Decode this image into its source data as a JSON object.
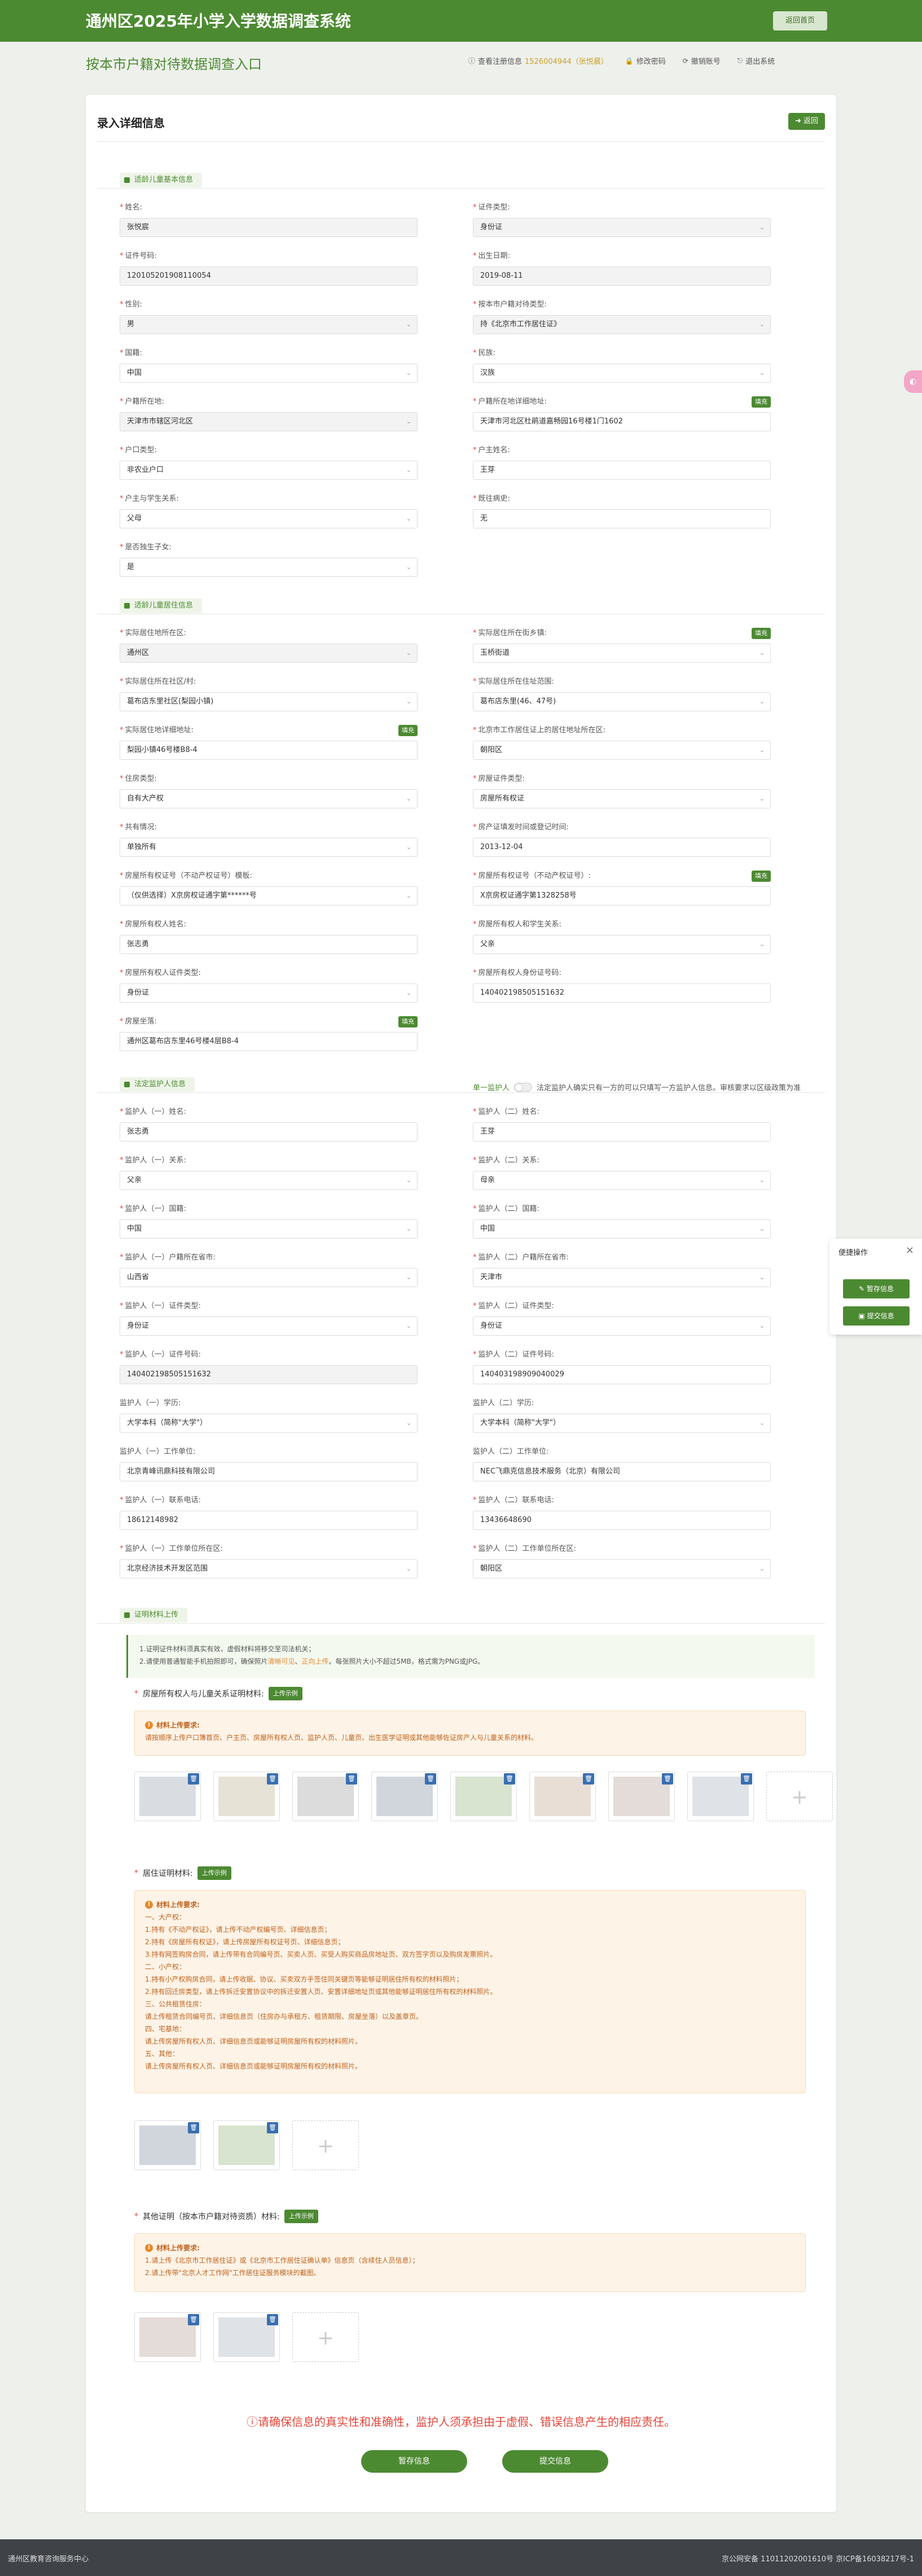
{
  "header": {
    "title": "通州区2025年小学入学数据调查系统",
    "home_button": "返回首页"
  },
  "subheader": {
    "subtitle": "按本市户籍对待数据调查入口",
    "reg_info_label": "查看注册信息",
    "reg_info_value": "1526004944（张悦晨）",
    "change_password": "修改密码",
    "cancel_account": "撤销账号",
    "logout": "退出系统"
  },
  "card": {
    "title": "录入详细信息",
    "back_button": "返回"
  },
  "sections": {
    "child_basic": "适龄儿童基本信息",
    "child_residence": "适龄儿童居住信息",
    "guardian": "法定监护人信息",
    "materials": "证明材料上传"
  },
  "child_basic": [
    {
      "label": "姓名:",
      "value": "张悦宸",
      "req": true,
      "dis": true,
      "select": false
    },
    {
      "label": "证件类型:",
      "value": "身份证",
      "req": true,
      "dis": true,
      "select": true
    },
    {
      "label": "证件号码:",
      "value": "120105201908110054",
      "req": true,
      "dis": true,
      "select": false
    },
    {
      "label": "出生日期:",
      "value": "2019-08-11",
      "req": true,
      "dis": true,
      "select": false
    },
    {
      "label": "性别:",
      "value": "男",
      "req": true,
      "dis": true,
      "select": true
    },
    {
      "label": "按本市户籍对待类型:",
      "value": "持《北京市工作居住证》",
      "req": true,
      "dis": true,
      "select": true
    },
    {
      "label": "国籍:",
      "value": "中国",
      "req": true,
      "dis": false,
      "select": true
    },
    {
      "label": "民族:",
      "value": "汉族",
      "req": true,
      "dis": false,
      "select": true
    },
    {
      "label": "户籍所在地:",
      "value": "天津市市辖区河北区",
      "req": true,
      "dis": true,
      "select": true
    },
    {
      "label": "户籍所在地详细地址:",
      "value": "天津市河北区杜鹃道嘉畅园16号楼1门1602",
      "req": true,
      "dis": false,
      "select": false,
      "fill": true
    },
    {
      "label": "户口类型:",
      "value": "非农业户口",
      "req": true,
      "dis": false,
      "select": true
    },
    {
      "label": "户主姓名:",
      "value": "王芽",
      "req": true,
      "dis": false,
      "select": false
    },
    {
      "label": "户主与学生关系:",
      "value": "父母",
      "req": true,
      "dis": false,
      "select": true
    },
    {
      "label": "既往病史:",
      "value": "无",
      "req": true,
      "dis": false,
      "select": false
    },
    {
      "label": "是否独生子女:",
      "value": "是",
      "req": true,
      "dis": false,
      "select": true
    }
  ],
  "child_residence": [
    {
      "label": "实际居住地所在区:",
      "value": "通州区",
      "req": true,
      "dis": true,
      "select": true
    },
    {
      "label": "实际居住所在街乡镇:",
      "value": "玉桥街道",
      "req": true,
      "dis": false,
      "select": true,
      "fill": true
    },
    {
      "label": "实际居住所在社区/村:",
      "value": "葛布店东里社区(梨园小镇)",
      "req": true,
      "dis": false,
      "select": true
    },
    {
      "label": "实际居住所在住址范围:",
      "value": "葛布店东里(46、47号)",
      "req": true,
      "dis": false,
      "select": true
    },
    {
      "label": "实际居住地详细地址:",
      "value": "梨园小镇46号楼B8-4",
      "req": true,
      "dis": false,
      "select": false,
      "fill": true
    },
    {
      "label": "北京市工作居住证上的居住地址所在区:",
      "value": "朝阳区",
      "req": true,
      "dis": false,
      "select": true
    },
    {
      "label": "住房类型:",
      "value": "自有大产权",
      "req": true,
      "dis": false,
      "select": true
    },
    {
      "label": "房屋证件类型:",
      "value": "房屋所有权证",
      "req": true,
      "dis": false,
      "select": true
    },
    {
      "label": "共有情况:",
      "value": "单独所有",
      "req": true,
      "dis": false,
      "select": true
    },
    {
      "label": "房产证填发时间或登记时间:",
      "value": "2013-12-04",
      "req": true,
      "dis": false,
      "select": false
    },
    {
      "label": "房屋所有权证号（不动产权证号）模板:",
      "value": "（仅供选择）X京房权证通字第******号",
      "req": true,
      "dis": false,
      "select": true
    },
    {
      "label": "房屋所有权证号（不动产权证号）:",
      "value": "X京房权证通字第1328258号",
      "req": true,
      "dis": false,
      "select": false,
      "fill": true
    },
    {
      "label": "房屋所有权人姓名:",
      "value": "张志勇",
      "req": true,
      "dis": false,
      "select": false
    },
    {
      "label": "房屋所有权人和学生关系:",
      "value": "父亲",
      "req": true,
      "dis": false,
      "select": true
    },
    {
      "label": "房屋所有权人证件类型:",
      "value": "身份证",
      "req": true,
      "dis": false,
      "select": true
    },
    {
      "label": "房屋所有权人身份证号码:",
      "value": "140402198505151632",
      "req": true,
      "dis": false,
      "select": false
    },
    {
      "label": "房屋坐落:",
      "value": "通州区葛布店东里46号楼4层B8-4",
      "req": true,
      "dis": false,
      "select": false,
      "fill": true
    }
  ],
  "guardian_switch": {
    "label": "单一监护人",
    "note": "法定监护人确实只有一方的可以只填写一方监护人信息。审核要求以区级政策为准"
  },
  "guardian": [
    {
      "label": "监护人（一）姓名:",
      "value": "张志勇",
      "req": true,
      "dis": false,
      "select": false
    },
    {
      "label": "监护人（二）姓名:",
      "value": "王芽",
      "req": true,
      "dis": false,
      "select": false
    },
    {
      "label": "监护人（一）关系:",
      "value": "父亲",
      "req": true,
      "dis": false,
      "select": true
    },
    {
      "label": "监护人（二）关系:",
      "value": "母亲",
      "req": true,
      "dis": false,
      "select": true
    },
    {
      "label": "监护人（一）国籍:",
      "value": "中国",
      "req": true,
      "dis": false,
      "select": true
    },
    {
      "label": "监护人（二）国籍:",
      "value": "中国",
      "req": true,
      "dis": false,
      "select": true
    },
    {
      "label": "监护人（一）户籍所在省市:",
      "value": "山西省",
      "req": true,
      "dis": false,
      "select": true
    },
    {
      "label": "监护人（二）户籍所在省市:",
      "value": "天津市",
      "req": true,
      "dis": false,
      "select": true
    },
    {
      "label": "监护人（一）证件类型:",
      "value": "身份证",
      "req": true,
      "dis": false,
      "select": true
    },
    {
      "label": "监护人（二）证件类型:",
      "value": "身份证",
      "req": true,
      "dis": false,
      "select": true
    },
    {
      "label": "监护人（一）证件号码:",
      "value": "140402198505151632",
      "req": true,
      "dis": true,
      "select": false
    },
    {
      "label": "监护人（二）证件号码:",
      "value": "140403198909040029",
      "req": true,
      "dis": false,
      "select": false
    },
    {
      "label": "监护人（一）学历:",
      "value": "大学本科（简称\"大学\"）",
      "req": false,
      "dis": false,
      "select": true
    },
    {
      "label": "监护人（二）学历:",
      "value": "大学本科（简称\"大学\"）",
      "req": false,
      "dis": false,
      "select": true
    },
    {
      "label": "监护人（一）工作单位:",
      "value": "北京青峰讯鼎科技有限公司",
      "req": false,
      "dis": false,
      "select": false
    },
    {
      "label": "监护人（二）工作单位:",
      "value": "NEC飞鼎克信息技术服务（北京）有限公司",
      "req": false,
      "dis": false,
      "select": false
    },
    {
      "label": "监护人（一）联系电话:",
      "value": "18612148982",
      "req": true,
      "dis": false,
      "select": false
    },
    {
      "label": "监护人（二）联系电话:",
      "value": "13436648690",
      "req": true,
      "dis": false,
      "select": false
    },
    {
      "label": "监护人（一）工作单位所在区:",
      "value": "北京经济技术开发区范围",
      "req": true,
      "dis": false,
      "select": true
    },
    {
      "label": "监护人（二）工作单位所在区:",
      "value": "朝阳区",
      "req": true,
      "dis": false,
      "select": true
    }
  ],
  "notice": {
    "line1": "1.证明证件材料须真实有效，虚假材料将移交至司法机关；",
    "line2_prefix": "2.请使用普通智能手机拍照即可，确保照片",
    "line2_hl1": "清晰可见",
    "line2_sep": "、",
    "line2_hl2": "正向上传",
    "line2_suffix": "。每张照片大小不超过5MB，格式需为PNG或JPG。"
  },
  "uploads": [
    {
      "title": "房屋所有权人与儿童关系证明材料:",
      "example": "上传示例",
      "req_title": "材料上传要求:",
      "req_lines": [
        "请按顺序上传户口簿首页、户主页、房屋所有权人页、监护人页、儿童页、出生医学证明或其他能够佐证房产人与儿童关系的材料。"
      ],
      "thumb_count": 8
    },
    {
      "title": "居住证明材料:",
      "example": "上传示例",
      "req_title": "材料上传要求:",
      "req_lines": [
        "一、大产权：",
        "1.持有《不动产权证》，请上传不动产权编号页、详细信息页；",
        "2.持有《房屋所有权证》，请上传房屋所有权证号页、详细信息页；",
        "3.持有网签购房合同，请上传带有合同编号页、买卖人页、买受人购买商品房地址页、双方签字页以及购房发票照片。",
        "二、小产权：",
        "1.持有小产权购房合同，请上传收据、协议、买卖双方手签住同关键页等能够证明居住所有权的材料照片；",
        "2.持有回迁房类型，请上传拆迁安置协议中的拆迁安置人页、安置详细地址页或其他能够证明居住所有权的材料照片。",
        "三、公共租赁住房：",
        "请上传租赁合同编号页、详细信息页（住房办与承租方、租赁期限、房屋坐落）以及盖章页。",
        "四、宅基地：",
        "请上传房屋所有权人页、详细信息页或能够证明房屋所有权的材料照片。",
        "五、其他：",
        "请上传房屋所有权人页、详细信息页或能够证明房屋所有权的材料照片。"
      ],
      "thumb_count": 2
    },
    {
      "title": "其他证明（按本市户籍对待资质）材料:",
      "example": "上传示例",
      "req_title": "材料上传要求:",
      "req_lines": [
        "1.请上传《北京市工作居住证》或《北京市工作居住证确认单》信息页（含续住人员信息）；",
        "2.请上传带\"北京人才工作网\"工作居住证服务模块的截图。"
      ],
      "thumb_count": 2
    }
  ],
  "warning": "ⓘ请确保信息的真实性和准确性，监护人须承担由于虚假、错误信息产生的相应责任。",
  "actions": {
    "save": "暂存信息",
    "submit": "提交信息"
  },
  "float_panel": {
    "title": "便捷操作",
    "save": "暂存信息",
    "submit": "提交信息"
  },
  "footer": {
    "left": "通州区教育咨询服务中心",
    "right": "京公网安备 11011202001610号  京ICP备16038217号-1"
  },
  "labels": {
    "fill_btn": "填充"
  },
  "colors": {
    "brand": "#4c8a32",
    "required": "#e2463b",
    "warning_bg": "#fdf3e6"
  }
}
